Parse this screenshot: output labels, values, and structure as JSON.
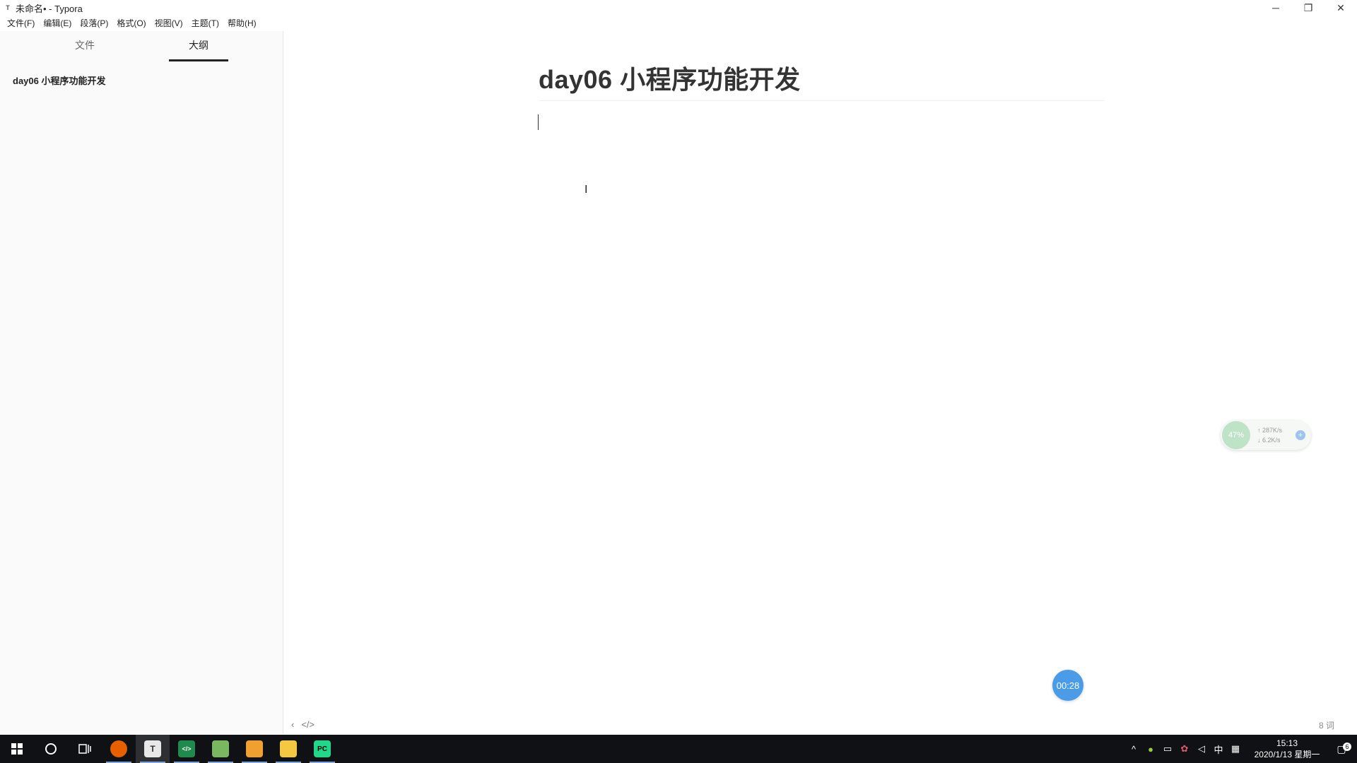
{
  "window": {
    "icon_letter": "T",
    "title": "未命名• - Typora",
    "minimize_icon": "minimize-icon",
    "restore_icon": "restore-icon",
    "close_icon": "close-icon"
  },
  "menu": [
    {
      "label": "文件(F)"
    },
    {
      "label": "编辑(E)"
    },
    {
      "label": "段落(P)"
    },
    {
      "label": "格式(O)"
    },
    {
      "label": "视图(V)"
    },
    {
      "label": "主题(T)"
    },
    {
      "label": "帮助(H)"
    }
  ],
  "sidebar": {
    "tabs": [
      {
        "label": "文件",
        "active": false
      },
      {
        "label": "大纲",
        "active": true
      }
    ],
    "outline": [
      {
        "label": "day06 小程序功能开发"
      }
    ]
  },
  "editor": {
    "heading": "day06 小程序功能开发",
    "word_count": "8 词"
  },
  "statusbar": {
    "back_glyph": "‹",
    "source_glyph": "</>"
  },
  "netmon": {
    "percent": "47%",
    "upload": "↑ 287K/s",
    "download": "↓ 6.2K/s",
    "boost_glyph": "+"
  },
  "timer": {
    "label": "00:28"
  },
  "taskbar": {
    "apps": [
      {
        "name": "firefox",
        "letter": "",
        "color": "#e66000"
      },
      {
        "name": "typora",
        "letter": "T",
        "color": "#e8e8e8"
      },
      {
        "name": "code-editor",
        "letter": "</>",
        "color": "#1f8a4c"
      },
      {
        "name": "notepad",
        "letter": "",
        "color": "#7bb661"
      },
      {
        "name": "remote-app",
        "letter": "",
        "color": "#f0a030"
      },
      {
        "name": "file-explorer",
        "letter": "",
        "color": "#f5c842"
      },
      {
        "name": "pycharm",
        "letter": "PC",
        "color": "#21d789"
      }
    ],
    "tray": {
      "ime": "中",
      "time": "15:13",
      "date": "2020/1/13 星期一",
      "notification_count": "6"
    }
  }
}
